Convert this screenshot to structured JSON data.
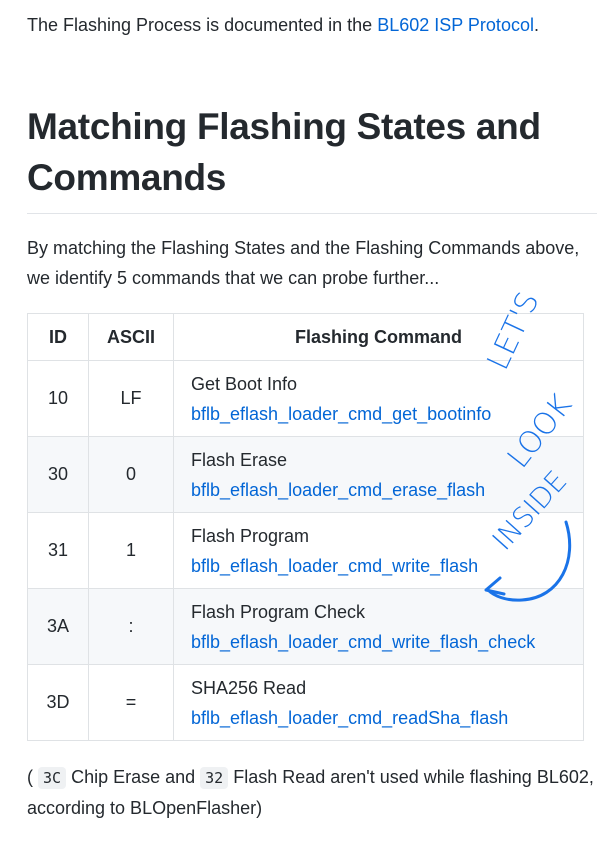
{
  "intro": {
    "text_before": "The Flashing Process is documented in the ",
    "link_text": "BL602 ISP Protocol",
    "text_after": "."
  },
  "heading": "Matching Flashing States and Commands",
  "paragraph": "By matching the Flashing States and the Flashing Commands above, we identify 5 commands that we can probe further...",
  "table": {
    "headers": [
      "ID",
      "ASCII",
      "Flashing Command"
    ],
    "rows": [
      {
        "id": "10",
        "ascii": "LF",
        "name": "Get Boot Info",
        "fn": "bflb_eflash_loader_cmd_get_bootinfo"
      },
      {
        "id": "30",
        "ascii": "0",
        "name": "Flash Erase",
        "fn": "bflb_eflash_loader_cmd_erase_flash"
      },
      {
        "id": "31",
        "ascii": "1",
        "name": "Flash Program",
        "fn": "bflb_eflash_loader_cmd_write_flash"
      },
      {
        "id": "3A",
        "ascii": ":",
        "name": "Flash Program Check",
        "fn": "bflb_eflash_loader_cmd_write_flash_check"
      },
      {
        "id": "3D",
        "ascii": "=",
        "name": "SHA256 Read",
        "fn": "bflb_eflash_loader_cmd_readSha_flash"
      }
    ]
  },
  "footnote": {
    "open": "( ",
    "code1": "3C",
    "mid1": " Chip Erase and ",
    "code2": "32",
    "rest": " Flash Read aren't used while flashing BL602, according to BLOpenFlasher)"
  },
  "annotation": {
    "word1": "LET'S",
    "word2": "LOOK",
    "word3": "INSIDE",
    "color": "#1a73e8"
  }
}
